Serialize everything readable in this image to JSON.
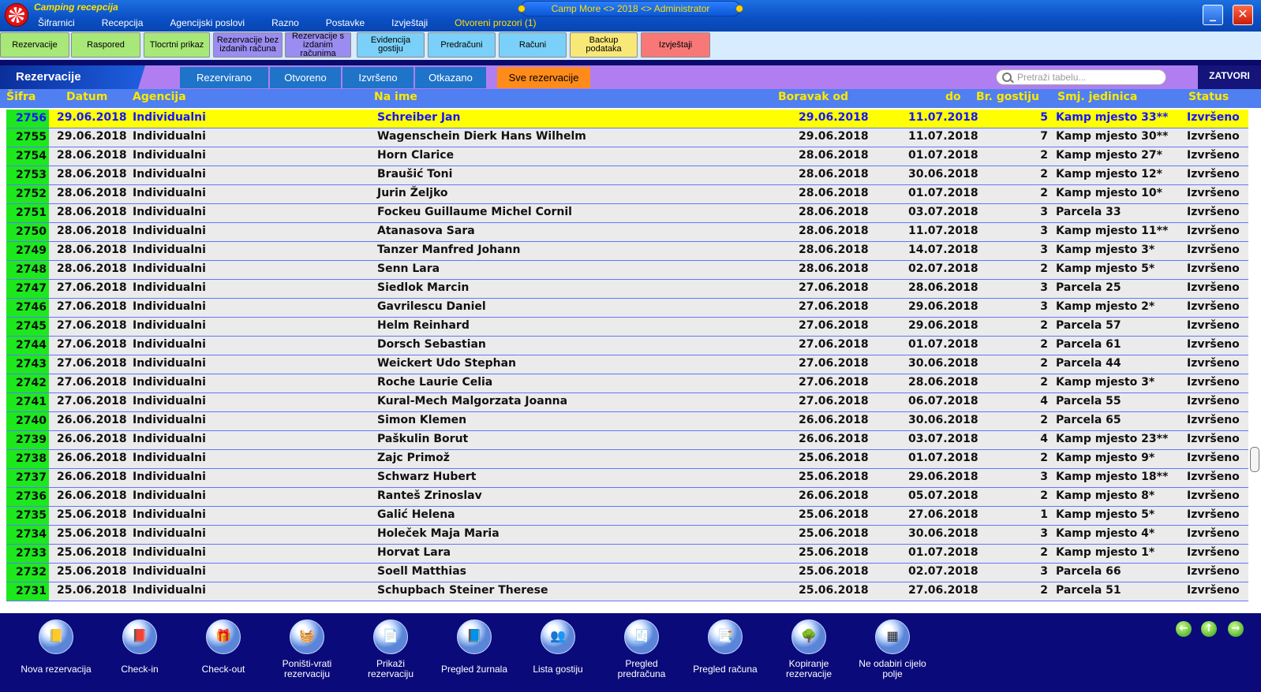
{
  "window": {
    "app_name": "Camping recepcija",
    "center_title": "Camp More <> 2018 <> Administrator",
    "menu": [
      "Šifrarnici",
      "Recepcija",
      "Agencijski poslovi",
      "Razno",
      "Postavke",
      "Izvještaji",
      "Otvoreni prozori (1)"
    ],
    "minimize": "_",
    "close": "✕"
  },
  "toolbar": [
    {
      "label": "Rezervacije",
      "color": "#a8e878"
    },
    {
      "label": "Raspored",
      "color": "#a8e878"
    },
    {
      "label": "Tlocrtni prikaz",
      "color": "#a8e878"
    },
    {
      "label": "Rezervacije bez izdanih računa",
      "color": "#9a8cf0"
    },
    {
      "label": "Rezervacije s izdanim računima",
      "color": "#9a8cf0"
    },
    {
      "label": "Evidencija gostiju",
      "color": "#7ad0f8"
    },
    {
      "label": "Predračuni",
      "color": "#7ad0f8"
    },
    {
      "label": "Računi",
      "color": "#7ad0f8"
    },
    {
      "label": "Backup podataka",
      "color": "#f8e878"
    },
    {
      "label": "Izvještaji",
      "color": "#f87878"
    }
  ],
  "section_title": "Rezervacije",
  "tabs": [
    {
      "label": "Rezervirano",
      "active": false
    },
    {
      "label": "Otvoreno",
      "active": false
    },
    {
      "label": "Izvršeno",
      "active": false
    },
    {
      "label": "Otkazano",
      "active": false
    },
    {
      "label": "Sve rezervacije",
      "active": true
    }
  ],
  "search": {
    "placeholder": "Pretraži tabelu..."
  },
  "close_button": "ZATVORI",
  "table": {
    "headers": {
      "sifra": "Šifra",
      "datum": "Datum",
      "agencija": "Agencija",
      "na_ime": "Na ime",
      "boravak_od": "Boravak od",
      "do": "do",
      "br_gostiju": "Br. gostiju",
      "smj_jedinica": "Smj. jedinica",
      "status": "Status"
    },
    "selected_index": 0,
    "rows": [
      [
        "2756",
        "29.06.2018",
        "Individualni",
        "Schreiber Jan",
        "29.06.2018",
        "11.07.2018",
        "5",
        "Kamp mjesto 33**",
        "Izvršeno"
      ],
      [
        "2755",
        "29.06.2018",
        "Individualni",
        "Wagenschein Dierk Hans Wilhelm",
        "29.06.2018",
        "11.07.2018",
        "7",
        "Kamp mjesto 30**",
        "Izvršeno"
      ],
      [
        "2754",
        "28.06.2018",
        "Individualni",
        "Horn Clarice",
        "28.06.2018",
        "01.07.2018",
        "2",
        "Kamp mjesto 27*",
        "Izvršeno"
      ],
      [
        "2753",
        "28.06.2018",
        "Individualni",
        "Braušić Toni",
        "28.06.2018",
        "30.06.2018",
        "2",
        "Kamp mjesto 12*",
        "Izvršeno"
      ],
      [
        "2752",
        "28.06.2018",
        "Individualni",
        "Jurin Željko",
        "28.06.2018",
        "01.07.2018",
        "2",
        "Kamp mjesto 10*",
        "Izvršeno"
      ],
      [
        "2751",
        "28.06.2018",
        "Individualni",
        "Fockeu Guillaume Michel Cornil",
        "28.06.2018",
        "03.07.2018",
        "3",
        "Parcela 33",
        "Izvršeno"
      ],
      [
        "2750",
        "28.06.2018",
        "Individualni",
        "Atanasova Sara",
        "28.06.2018",
        "11.07.2018",
        "3",
        "Kamp mjesto 11**",
        "Izvršeno"
      ],
      [
        "2749",
        "28.06.2018",
        "Individualni",
        "Tanzer Manfred Johann",
        "28.06.2018",
        "14.07.2018",
        "3",
        "Kamp mjesto 3*",
        "Izvršeno"
      ],
      [
        "2748",
        "28.06.2018",
        "Individualni",
        "Senn Lara",
        "28.06.2018",
        "02.07.2018",
        "2",
        "Kamp mjesto 5*",
        "Izvršeno"
      ],
      [
        "2747",
        "27.06.2018",
        "Individualni",
        "Siedlok Marcin",
        "27.06.2018",
        "28.06.2018",
        "3",
        "Parcela 25",
        "Izvršeno"
      ],
      [
        "2746",
        "27.06.2018",
        "Individualni",
        "Gavrilescu Daniel",
        "27.06.2018",
        "29.06.2018",
        "3",
        "Kamp mjesto 2*",
        "Izvršeno"
      ],
      [
        "2745",
        "27.06.2018",
        "Individualni",
        "Helm Reinhard",
        "27.06.2018",
        "29.06.2018",
        "2",
        "Parcela 57",
        "Izvršeno"
      ],
      [
        "2744",
        "27.06.2018",
        "Individualni",
        "Dorsch Sebastian",
        "27.06.2018",
        "01.07.2018",
        "2",
        "Parcela 61",
        "Izvršeno"
      ],
      [
        "2743",
        "27.06.2018",
        "Individualni",
        "Weickert Udo Stephan",
        "27.06.2018",
        "30.06.2018",
        "2",
        "Parcela 44",
        "Izvršeno"
      ],
      [
        "2742",
        "27.06.2018",
        "Individualni",
        "Roche Laurie Celia",
        "27.06.2018",
        "28.06.2018",
        "2",
        "Kamp mjesto 3*",
        "Izvršeno"
      ],
      [
        "2741",
        "27.06.2018",
        "Individualni",
        "Kural-Mech Malgorzata Joanna",
        "27.06.2018",
        "06.07.2018",
        "4",
        "Parcela 55",
        "Izvršeno"
      ],
      [
        "2740",
        "26.06.2018",
        "Individualni",
        "Simon Klemen",
        "26.06.2018",
        "30.06.2018",
        "2",
        "Parcela 65",
        "Izvršeno"
      ],
      [
        "2739",
        "26.06.2018",
        "Individualni",
        "Paškulin Borut",
        "26.06.2018",
        "03.07.2018",
        "4",
        "Kamp mjesto 23**",
        "Izvršeno"
      ],
      [
        "2738",
        "26.06.2018",
        "Individualni",
        "Zajc Primož",
        "25.06.2018",
        "01.07.2018",
        "2",
        "Kamp mjesto 9*",
        "Izvršeno"
      ],
      [
        "2737",
        "26.06.2018",
        "Individualni",
        "Schwarz Hubert",
        "25.06.2018",
        "29.06.2018",
        "3",
        "Kamp mjesto 18**",
        "Izvršeno"
      ],
      [
        "2736",
        "26.06.2018",
        "Individualni",
        "Ranteš Zrinoslav",
        "26.06.2018",
        "05.07.2018",
        "2",
        "Kamp mjesto 8*",
        "Izvršeno"
      ],
      [
        "2735",
        "25.06.2018",
        "Individualni",
        "Galić Helena",
        "25.06.2018",
        "27.06.2018",
        "1",
        "Kamp mjesto 5*",
        "Izvršeno"
      ],
      [
        "2734",
        "25.06.2018",
        "Individualni",
        "Holeček Maja Maria",
        "25.06.2018",
        "30.06.2018",
        "3",
        "Kamp mjesto 4*",
        "Izvršeno"
      ],
      [
        "2733",
        "25.06.2018",
        "Individualni",
        "Horvat Lara",
        "25.06.2018",
        "01.07.2018",
        "2",
        "Kamp mjesto 1*",
        "Izvršeno"
      ],
      [
        "2732",
        "25.06.2018",
        "Individualni",
        "Soell Matthias",
        "25.06.2018",
        "02.07.2018",
        "3",
        "Parcela 66",
        "Izvršeno"
      ],
      [
        "2731",
        "25.06.2018",
        "Individualni",
        "Schupbach Steiner Therese",
        "25.06.2018",
        "27.06.2018",
        "2",
        "Parcela 51",
        "Izvršeno"
      ]
    ]
  },
  "bottom_actions": [
    {
      "label": "Nova rezervacija",
      "icon": "notebook-icon",
      "glyph": "📒"
    },
    {
      "label": "Check-in",
      "icon": "book-in-icon",
      "glyph": "📕"
    },
    {
      "label": "Check-out",
      "icon": "gift-box-icon",
      "glyph": "🎁"
    },
    {
      "label": "Poništi-vrati rezervaciju",
      "icon": "basket-icon",
      "glyph": "🧺"
    },
    {
      "label": "Prikaži rezervaciju",
      "icon": "document-icon",
      "glyph": "📄"
    },
    {
      "label": "Pregled žurnala",
      "icon": "journal-icon",
      "glyph": "📘"
    },
    {
      "label": "Lista gostiju",
      "icon": "guests-icon",
      "glyph": "👥"
    },
    {
      "label": "Pregled predračuna",
      "icon": "invoice-draft-icon",
      "glyph": "🧾"
    },
    {
      "label": "Pregled računa",
      "icon": "invoice-icon",
      "glyph": "📑"
    },
    {
      "label": "Kopiranje rezervacije",
      "icon": "copy-tree-icon",
      "glyph": "🌳"
    },
    {
      "label": "Ne odabiri cijelo polje",
      "icon": "grid-select-icon",
      "glyph": "▦"
    }
  ],
  "nav": {
    "left": "←",
    "up": "↑",
    "right": "→"
  }
}
